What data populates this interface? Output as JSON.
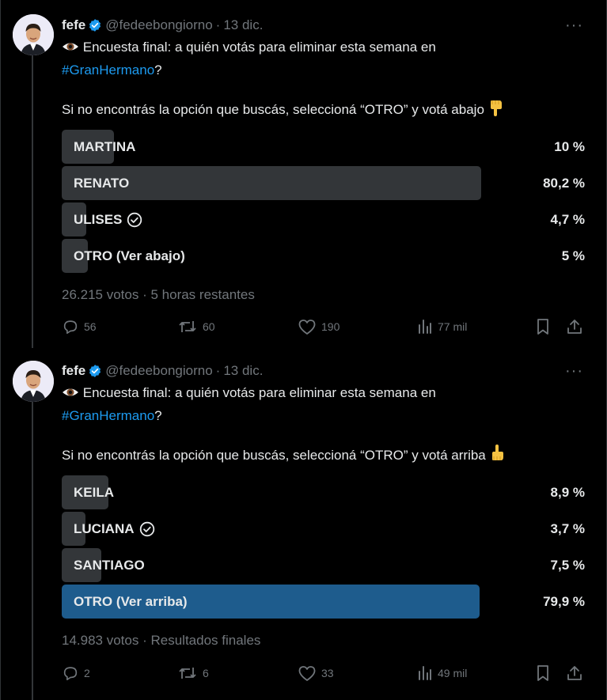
{
  "tweets": [
    {
      "author": {
        "name": "fefe",
        "handle": "@fedeebongiorno",
        "date": "13 dic."
      },
      "line1": "Encuesta final: a quién votás para eliminar esta semana en",
      "hashtag": "#GranHermano",
      "after_hashtag": "?",
      "line2": "Si no encontrás la opción que buscás, seleccioná “OTRO” y votá abajo",
      "options": [
        {
          "label": "MARTINA",
          "percent": "10 %",
          "fraction": 0.1,
          "checked": false
        },
        {
          "label": "RENATO",
          "percent": "80,2 %",
          "fraction": 0.802,
          "checked": false
        },
        {
          "label": "ULISES",
          "percent": "4,7 %",
          "fraction": 0.047,
          "checked": true
        },
        {
          "label": "OTRO (Ver abajo)",
          "percent": "5 %",
          "fraction": 0.05,
          "checked": false
        }
      ],
      "votes": "26.215 votos",
      "status": "5 horas restantes",
      "stats": {
        "replies": "56",
        "retweets": "60",
        "likes": "190",
        "views": "77 mil"
      }
    },
    {
      "author": {
        "name": "fefe",
        "handle": "@fedeebongiorno",
        "date": "13 dic."
      },
      "line1": "Encuesta final: a quién votás para eliminar esta semana en",
      "hashtag": "#GranHermano",
      "after_hashtag": "?",
      "line2": "Si no encontrás la opción que buscás, seleccioná “OTRO” y votá arriba",
      "options": [
        {
          "label": "KEILA",
          "percent": "8,9 %",
          "fraction": 0.089,
          "checked": false
        },
        {
          "label": "LUCIANA",
          "percent": "3,7 %",
          "fraction": 0.037,
          "checked": true
        },
        {
          "label": "SANTIAGO",
          "percent": "7,5 %",
          "fraction": 0.075,
          "checked": false
        },
        {
          "label": "OTRO (Ver arriba)",
          "percent": "79,9 %",
          "fraction": 0.799,
          "checked": false,
          "winner": true
        }
      ],
      "votes": "14.983 votos",
      "status": "Resultados finales",
      "stats": {
        "replies": "2",
        "retweets": "6",
        "likes": "33",
        "views": "49 mil"
      }
    }
  ],
  "colors": {
    "accent": "#1d9bf0",
    "muted": "#71767b",
    "bar": "#333639",
    "winner_bar": "#1e5c8d"
  },
  "icons": [
    "verified-badge-icon",
    "eye-icon",
    "hand-pointing-down-icon",
    "hand-pointing-up-icon",
    "check-circle-icon",
    "more-icon",
    "reply-icon",
    "retweet-icon",
    "like-icon",
    "views-icon",
    "bookmark-icon",
    "share-icon"
  ]
}
